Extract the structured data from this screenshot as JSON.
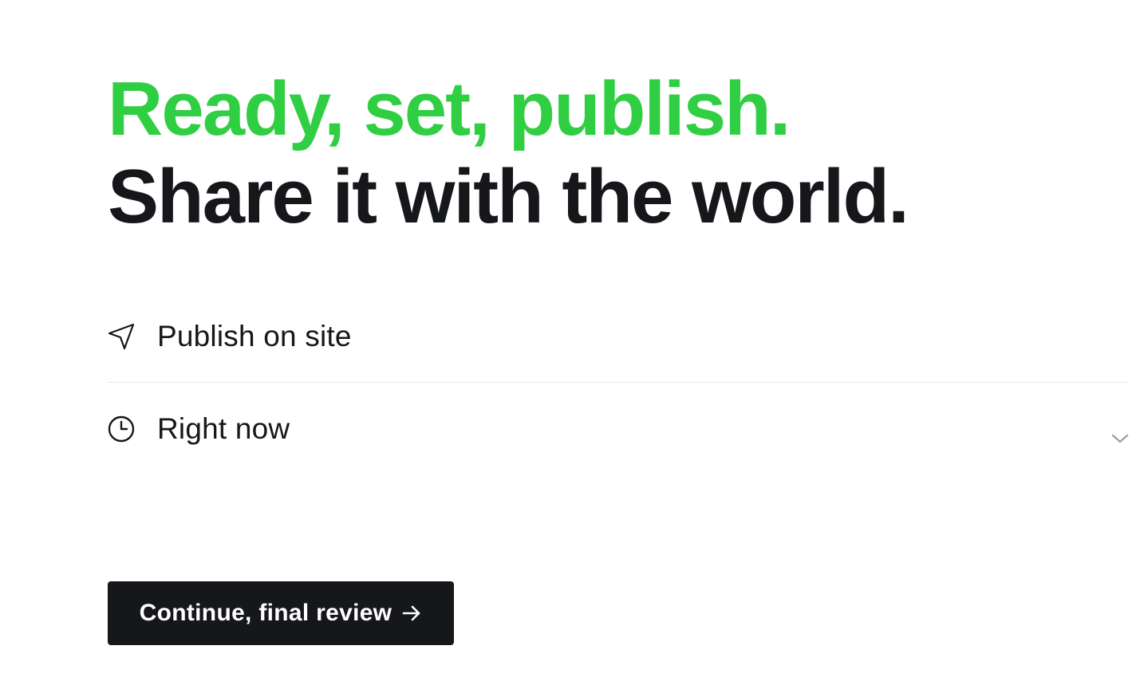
{
  "headline": {
    "line_1": "Ready, set, publish.",
    "line_2": "Share it with the world."
  },
  "options": [
    {
      "label": "Publish on site",
      "icon": "send-icon"
    },
    {
      "label": "Right now",
      "icon": "clock-icon",
      "has_dropdown": true,
      "dropdown_icon": "chevron-down-icon"
    }
  ],
  "continue_button": {
    "label": "Continue, final review",
    "icon": "arrow-right-icon"
  },
  "colors": {
    "accent": "#30cf43",
    "text": "#15171a",
    "divider": "#e2e5e8",
    "chevron": "#9aa2ab",
    "button_bg": "#15171a",
    "button_text": "#ffffff"
  }
}
